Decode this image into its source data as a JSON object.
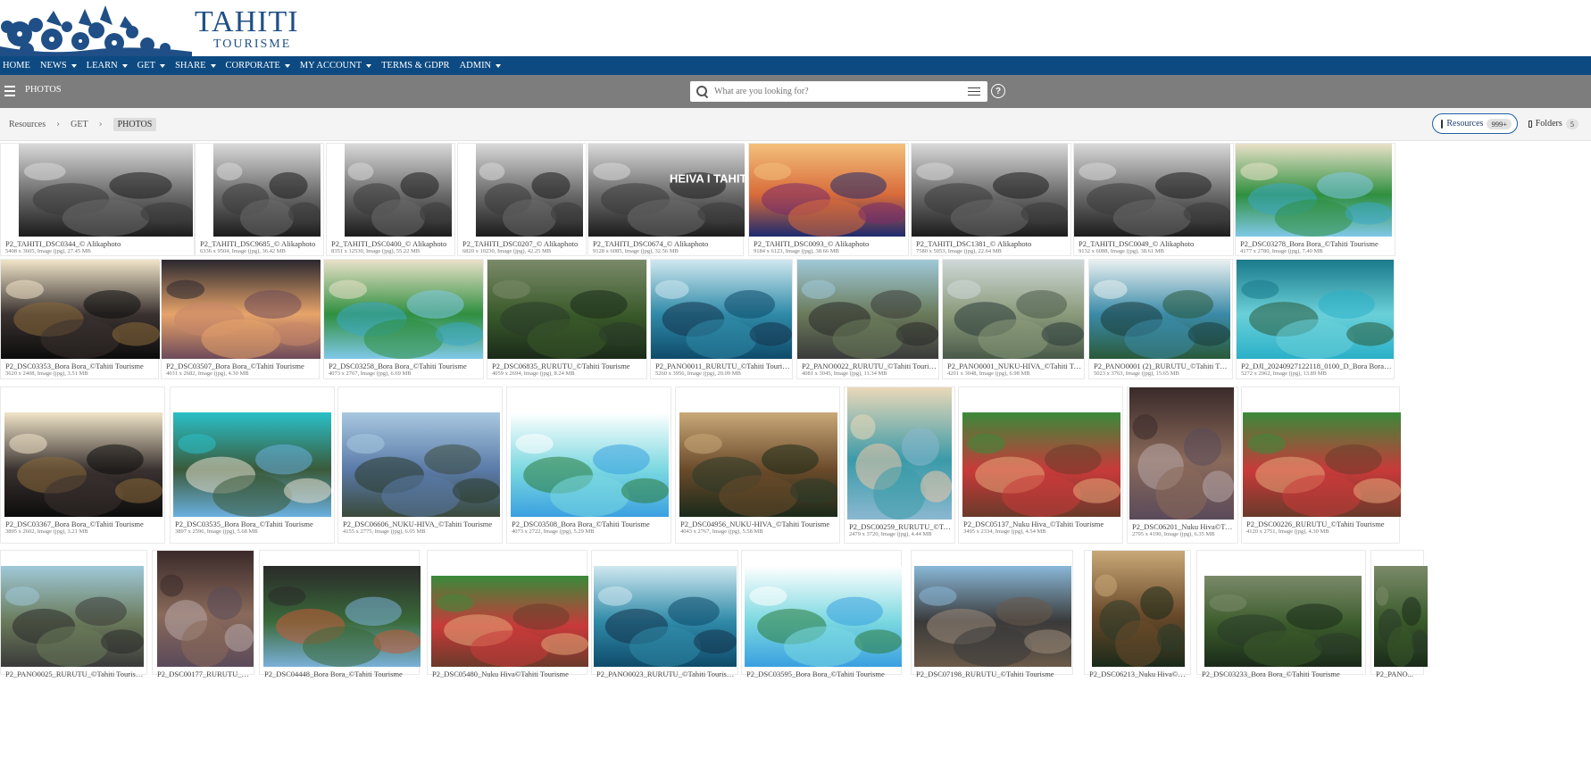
{
  "brand": {
    "name": "TAHITI",
    "sub": "TOURISME"
  },
  "nav": [
    {
      "label": "HOME",
      "caret": false
    },
    {
      "label": "NEWS",
      "caret": true
    },
    {
      "label": "LEARN",
      "caret": true
    },
    {
      "label": "GET",
      "caret": true
    },
    {
      "label": "SHARE",
      "caret": true
    },
    {
      "label": "CORPORATE",
      "caret": true
    },
    {
      "label": "MY ACCOUNT",
      "caret": true
    },
    {
      "label": "TERMS & GDPR",
      "caret": false
    },
    {
      "label": "ADMIN",
      "caret": true
    }
  ],
  "toolbar": {
    "title": "PHOTOS",
    "search_placeholder": "What are you looking for?",
    "help": "?"
  },
  "breadcrumb": {
    "items": [
      "Resources",
      "GET"
    ],
    "current": "PHOTOS"
  },
  "tabs": {
    "resources": {
      "label": "Resources",
      "count": "999+"
    },
    "folders": {
      "label": "Folders",
      "count": "5"
    }
  },
  "colors": {
    "nav": "#0d4a82",
    "toolbar": "#7d7d7d",
    "brand": "#1f4f86",
    "accent": "#1f5fa8"
  },
  "rows": [
    [
      {
        "title": "P2_TAHITI_DSC0344_© Alikaphoto",
        "meta": "5408 x 3605, Image (jpg), 27.45 MB",
        "scene": "bw"
      },
      {
        "title": "P2_TAHITI_DSC9685_© Alikaphoto",
        "meta": "6336 x 9504, Image (jpg), 36.42 MB",
        "scene": "bw"
      },
      {
        "title": "P2_TAHITI_DSC0400_© Alikaphoto",
        "meta": "8351 x 12530, Image (jpg), 55.22 MB",
        "scene": "bw"
      },
      {
        "title": "P2_TAHITI_DSC0207_© Alikaphoto",
        "meta": "6820 x 10230, Image (jpg), 42.25 MB",
        "scene": "bw"
      },
      {
        "title": "P2_TAHITI_DSC0674_© Alikaphoto",
        "meta": "9128 x 6085, Image (jpg), 32.56 MB",
        "scene": "bw"
      },
      {
        "title": "P2_TAHITI_DSC0093_© Alikaphoto",
        "meta": "9184 x 6123, Image (jpg), 38.66 MB",
        "scene": "stage"
      },
      {
        "title": "P2_TAHITI_DSC1381_© Alikaphoto",
        "meta": "7580 x 5053, Image (jpg), 22.64 MB",
        "scene": "bw"
      },
      {
        "title": "P2_TAHITI_DSC0049_© Alikaphoto",
        "meta": "9132 x 6088, Image (jpg), 38.61 MB",
        "scene": "bw"
      },
      {
        "title": "P2_DSC03278_Bora Bora_©Tahiti Tourisme",
        "meta": "4177 x 2780, Image (jpg), 7.40 MB",
        "scene": "beach"
      }
    ],
    [
      {
        "title": "P2_DSC03353_Bora Bora_©Tahiti Tourisme",
        "meta": "3620 x 2408, Image (jpg), 3.51 MB",
        "scene": "dessert"
      },
      {
        "title": "P2_DSC03507_Bora Bora_©Tahiti Tourisme",
        "meta": "4031 x 2682, Image (jpg), 4.30 MB",
        "scene": "sunset"
      },
      {
        "title": "P2_DSC03258_Bora Bora_©Tahiti Tourisme",
        "meta": "4073 x 2767, Image (jpg), 6.69 MB",
        "scene": "beach"
      },
      {
        "title": "P2_DSC06835_RURUTU_©Tahiti Tourisme",
        "meta": "4059 x 2694, Image (jpg), 8.24 MB",
        "scene": "forest"
      },
      {
        "title": "P2_PANO0011_RURUTU_©Tahiti Tourisme",
        "meta": "5260 x 3956, Image (jpg), 20.09 MB",
        "scene": "ocean"
      },
      {
        "title": "P2_PANO0022_RURUTU_©Tahiti Tourisme",
        "meta": "4081 x 3045, Image (jpg), 11.34 MB",
        "scene": "cliff"
      },
      {
        "title": "P2_PANO0001_NUKU-HIVA_©Tahiti Tourisme",
        "meta": "4201 x 3048, Image (jpg), 6.98 MB",
        "scene": "bay"
      },
      {
        "title": "P2_PANO0001 (2)_RURUTU_©Tahiti Tourisme",
        "meta": "5023 x 3763, Image (jpg), 15.65 MB",
        "scene": "coast"
      },
      {
        "title": "P2_DJI_20240927122118_0100_D_Bora Bora_©Tahiti Touris...",
        "meta": "5272 x 2962, Image (jpg), 13.89 MB",
        "scene": "lagoon"
      }
    ],
    [
      {
        "title": "P2_DSC03367_Bora Bora_©Tahiti Tourisme",
        "meta": "3895 x 2602, Image (jpg), 3.21 MB",
        "scene": "dessert"
      },
      {
        "title": "P2_DSC03535_Bora Bora_©Tahiti Tourisme",
        "meta": "3897 x 2596, Image (jpg), 5.68 MB",
        "scene": "jump"
      },
      {
        "title": "P2_DSC06606_NUKU-HIVA_©Tahiti Tourisme",
        "meta": "4155 x 2775, Image (jpg), 6.05 MB",
        "scene": "sail"
      },
      {
        "title": "P2_DSC03508_Bora Bora_©Tahiti Tourisme",
        "meta": "4073 x 2722, Image (jpg), 5.29 MB",
        "scene": "lagoon2"
      },
      {
        "title": "P2_DSC04956_NUKU-HIVA_©Tahiti Tourisme",
        "meta": "4043 x 2767, Image (jpg), 5.58 MB",
        "scene": "warrior"
      },
      {
        "title": "P2_DSC00259_RURUTU_©Tahiti To...",
        "meta": "2479 x 3720, Image (jpg), 4.44 MB",
        "scene": "woman"
      },
      {
        "title": "P2_DSC05137_Nuku Hiva_©Tahiti Tourisme",
        "meta": "3495 x 2334, Image (jpg), 4.54 MB",
        "scene": "dancers"
      },
      {
        "title": "P2_DSC06201_Nuku Hiva©Tahiti To...",
        "meta": "2795 x 4190, Image (jpg), 6.35 MB",
        "scene": "man"
      },
      {
        "title": "P2_DSC00226_RURUTU_©Tahiti Tourisme",
        "meta": "4120 x 2751, Image (jpg), 4.30 MB",
        "scene": "dancers"
      }
    ],
    [
      {
        "title": "P2_PANO0025_RURUTU_©Tahiti Tourisme",
        "meta": "",
        "scene": "cliff"
      },
      {
        "title": "P2_DSC00177_RURUTU_©Tahiti To...",
        "meta": "",
        "scene": "man"
      },
      {
        "title": "P2_DSC04448_Bora Bora_©Tahiti Tourisme",
        "meta": "",
        "scene": "couple"
      },
      {
        "title": "P2_DSC05480_Nuku Hiva©Tahiti Tourisme",
        "meta": "",
        "scene": "dancers"
      },
      {
        "title": "P2_PANO0023_RURUTU_©Tahiti Tourisme",
        "meta": "",
        "scene": "ocean"
      },
      {
        "title": "P2_DSC03595_Bora Bora_©Tahiti Tourisme",
        "meta": "",
        "scene": "lagoon2"
      },
      {
        "title": "P2_DSC07198_RURUTU_©Tahiti Tourisme",
        "meta": "",
        "scene": "cave"
      },
      {
        "title": "P2_DSC06213_Nuku Hiva©Tahiti Tourist...",
        "meta": "",
        "scene": "warrior"
      },
      {
        "title": "P2_DSC03233_Bora Bora_©Tahiti Tourisme",
        "meta": "",
        "scene": "forest"
      },
      {
        "title": "P2_PANO...",
        "meta": "",
        "scene": "forest"
      }
    ]
  ],
  "overlay_text": "HEIVA I TAHITI"
}
